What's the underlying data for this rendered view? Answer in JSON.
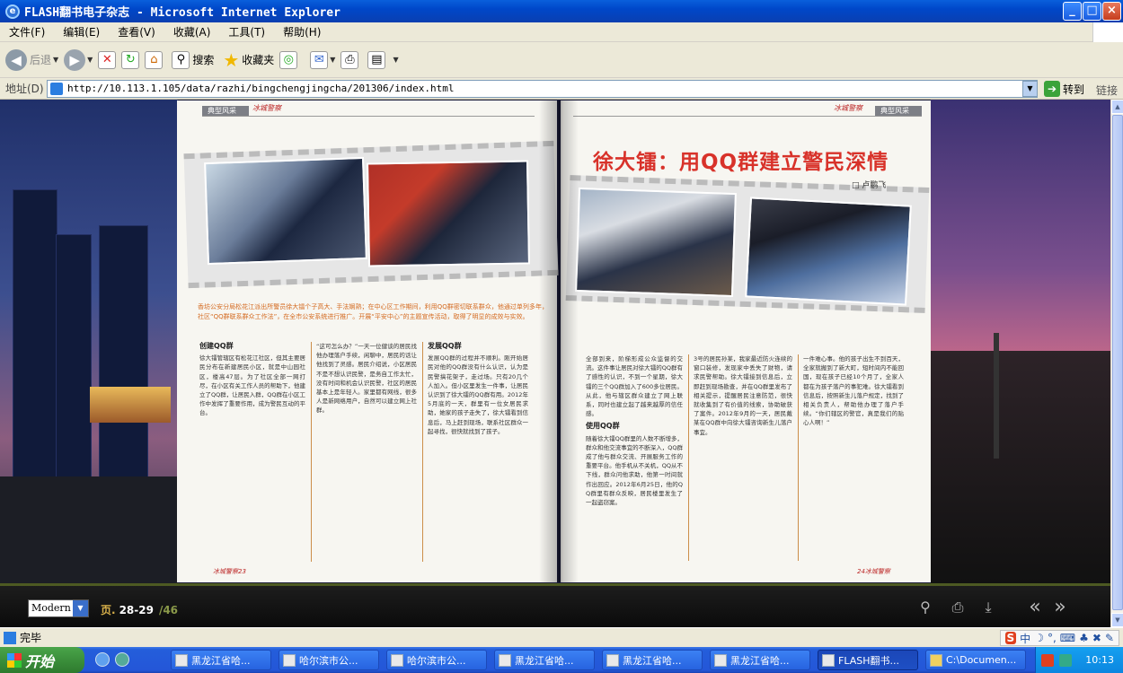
{
  "window": {
    "title": "FLASH翻书电子杂志 - Microsoft Internet Explorer",
    "minimize": "_",
    "maximize": "□",
    "close": "×"
  },
  "menu": [
    "文件(F)",
    "编辑(E)",
    "查看(V)",
    "收藏(A)",
    "工具(T)",
    "帮助(H)"
  ],
  "toolbar": {
    "back": "后退",
    "search": "搜索",
    "favorites": "收藏夹"
  },
  "address": {
    "label": "地址(D)",
    "url": "http://10.113.1.105/data/razhi/bingchengjingcha/201306/index.html",
    "go": "转到",
    "links": "链接"
  },
  "magazine": {
    "left_header": "典型风采",
    "left_header_logo": "冰城警察",
    "right_header": "典型风采",
    "right_header_logo": "冰城警察",
    "intro": "香坊公安分局松花江派出所警员徐大镭个子高大、手法娴熟；在中心区工作期间，利用QQ群密切联系群众，他通过单列多年，社区“QQ群联系群众工作法”，在全市公安系统进行推广。开展“平安中心”的主题宣传活动，取得了明显的成效与实效。",
    "left_col1_head": "创建QQ群",
    "left_col1": "徐大镭管辖区有松花江社区，但其主要居民分布在新建居民小区，就是中山园社区，楼高47层。为了社区全部一网打尽，在小区有关工作人员的帮助下，他建立了QQ群，让居民入群，QQ群在小区工作中发挥了重要作用，成为警民互动的平台。",
    "left_col2": "“这可怎么办？”一天一位健谈的居民找他办理落户手续，闲聊中，居民的话让他找到了灵感。居民介绍说，小区居民不是不想认识民警，是务自工作太忙，没有时间和机会认识民警，社区的居民基本上是年轻人。家里都有网线，很多人是新网络用户，自然可以建立网上社群。",
    "left_col3_head": "发展QQ群",
    "left_col3": "发展QQ群的过程并不顺利。刚开始居民对他的QQ群没有什么认识，认为是民警搞花架子，走过场。只有20几个人加入。但小区里发生一件事，让居民认识到了徐大镭的QQ群有用。2012年5月底的一天，群里有一位女居民求助，她家的孩子走失了，徐大镭看到信息后，马上赶到现场，联系社区群众一起寻找，很快就找到了孩子。",
    "right_title": "徐大镭：用QQ群建立警民深情",
    "author": "□ 卢鹏飞",
    "right_col1": "全部到来，阶梯形成公众监督的交流。这件事让居民对徐大镭的QQ群有了感性的认识，不到一个星期，徐大镭的三个QQ群加入了600多位居民。从此，他与辖区群众建立了网上联系，同时也建立起了越来越厚的信任感。",
    "right_col1_head": "使用QQ群",
    "right_col1b": "随着徐大镭QQ群里的人数不断增多，群众和他交流事宜的不断深入，QQ群成了他与群众交流、开展服务工作的重要平台。他手机从不关机，QQ从不下线，群众问他求助，他第一时间就作出回应。2012年6月25日，他的QQ群里有群众反映，居民楼里发生了一起盗窃案。",
    "right_col2": "3号的居民孙某，我家最近防火连续的窗口装修，发现家中丢失了财物，请求民警帮助。徐大镭接到信息后，立即赶到现场勘查，并在QQ群里发布了相关提示，提醒居民注意防范，很快就收集到了有价值的线索，协助破获了案件。2012年9月的一天，居民戴某在QQ群中向徐大镭咨询新生儿落户事宜。",
    "right_col3": "一件难心事。他的孩子出生不到百天，全家就搬到了新大町，短时间内不能回国，现在孩子已经10个月了，全家人都在为孩子落户的事犯难。徐大镭看到信息后，按照新生儿落户规定，找到了相关负责人，帮助他办理了落户手续。“你们辖区的警官，真是我们的贴心人啊！”",
    "left_page_num": "冰城警察23",
    "right_page_num": "24冰城警察"
  },
  "viewer": {
    "mode": "Modern",
    "page_label": "页.",
    "pages": "28-29",
    "total": "/46"
  },
  "status": {
    "text": "完毕"
  },
  "ime": [
    "S",
    "中",
    "☽",
    "°,",
    "⌨",
    "♣",
    "✖",
    "✎"
  ],
  "taskbar": {
    "start": "开始",
    "tasks": [
      "黑龙江省哈...",
      "哈尔滨市公...",
      "哈尔滨市公...",
      "黑龙江省哈...",
      "黑龙江省哈...",
      "黑龙江省哈...",
      "FLASH翻书...",
      "C:\\Documen..."
    ],
    "clock": "10:13"
  }
}
